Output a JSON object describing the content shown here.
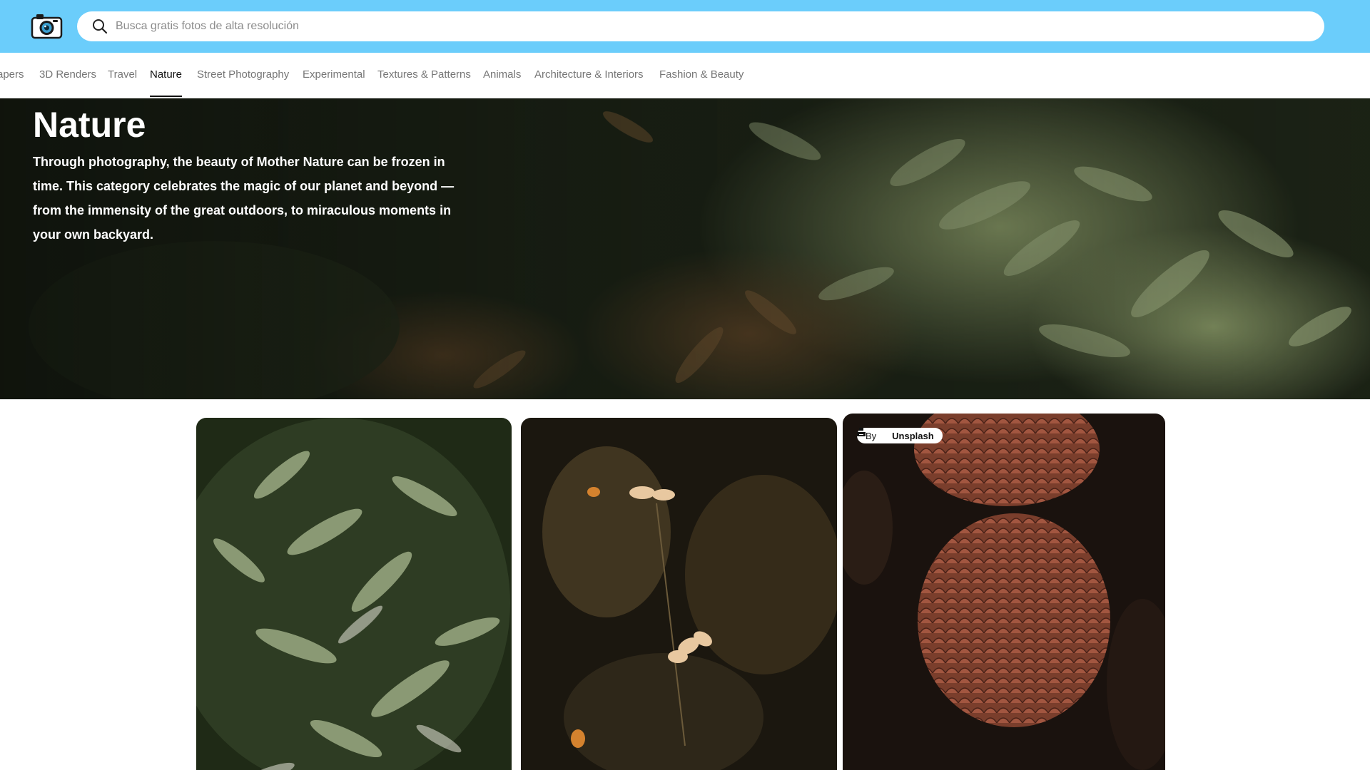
{
  "search": {
    "placeholder": "Busca gratis fotos de alta resolución"
  },
  "logo": {
    "icon": "camera-icon"
  },
  "categories": {
    "items": [
      {
        "label": "apers"
      },
      {
        "label": "3D Renders"
      },
      {
        "label": "Travel"
      },
      {
        "label": "Nature",
        "active": true
      },
      {
        "label": "Street Photography"
      },
      {
        "label": "Experimental"
      },
      {
        "label": "Textures & Patterns"
      },
      {
        "label": "Animals"
      },
      {
        "label": "Architecture & Interiors"
      },
      {
        "label": "Fashion & Beauty"
      }
    ]
  },
  "hero": {
    "title": "Nature",
    "description": "Through photography, the beauty of Mother Nature can be frozen in time. This category celebrates the magic of our planet and beyond — from the immensity of the great outdoors, to miraculous moments in your own backyard."
  },
  "photos": [
    {
      "subject": "fern-leaves"
    },
    {
      "subject": "dry-flowers"
    },
    {
      "subject": "pine-cones",
      "badge": {
        "by": "By",
        "brand": "Unsplash"
      }
    }
  ],
  "colors": {
    "topbar": "#6bcdfb",
    "active_text": "#111111",
    "inactive_text": "#767676"
  }
}
